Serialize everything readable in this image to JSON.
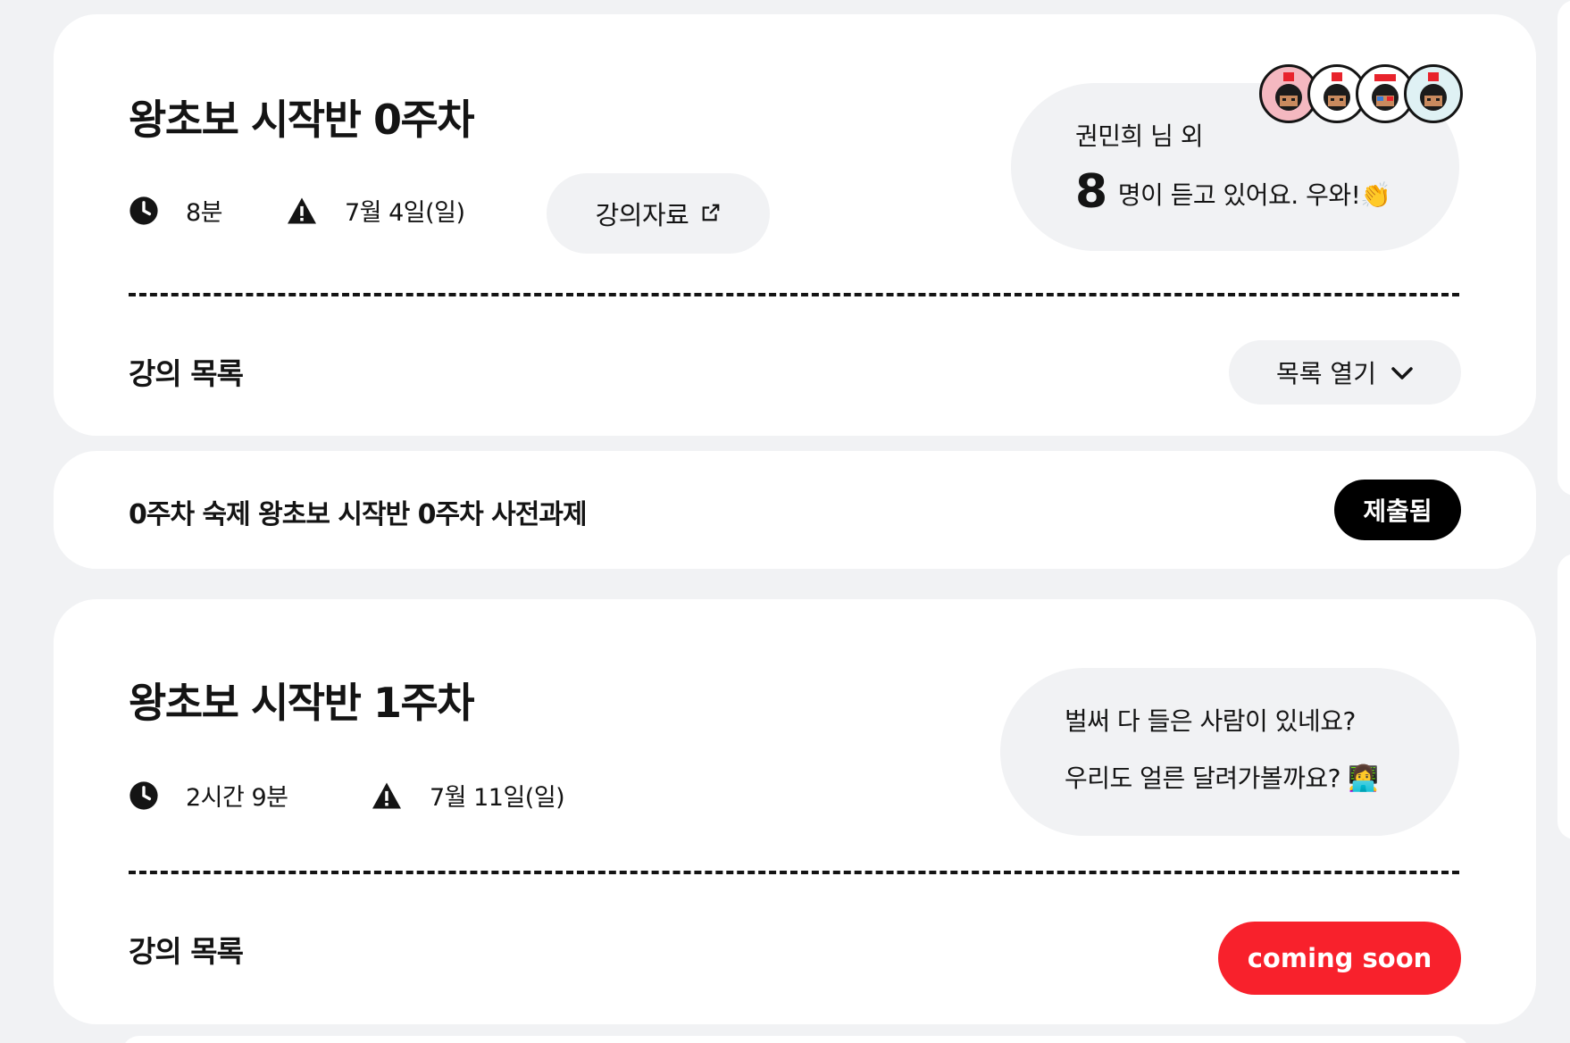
{
  "weeks": [
    {
      "title": "왕초보 시작반 0주차",
      "duration": "8분",
      "date": "7월 4일(일)",
      "material_label": "강의자료",
      "list_label": "강의 목록",
      "open_list_label": "목록 열기",
      "bubble": {
        "line1": "권민희 님 외",
        "count": "8",
        "line2": "명이 듣고 있어요. 우와!👏"
      }
    },
    {
      "title": "왕초보 시작반 1주차",
      "duration": "2시간 9분",
      "date": "7월 11일(일)",
      "list_label": "강의 목록",
      "status_label": "coming soon",
      "bubble": {
        "line1": "벌써 다 들은 사람이 있네요?",
        "line2": "우리도 얼른 달려가볼까요? 👩‍💻"
      }
    }
  ],
  "homework": {
    "text": "0주차 숙제 왕초보 시작반 0주차 사전과제",
    "status_label": "제출됨"
  },
  "icons": [
    "clock-icon",
    "warning-icon",
    "external-link-icon",
    "chevron-down-icon",
    "avatar"
  ],
  "colors": {
    "background": "#f1f2f4",
    "card": "#ffffff",
    "text": "#141414",
    "submitted_badge": "#000000",
    "coming_soon": "#f8212c"
  }
}
